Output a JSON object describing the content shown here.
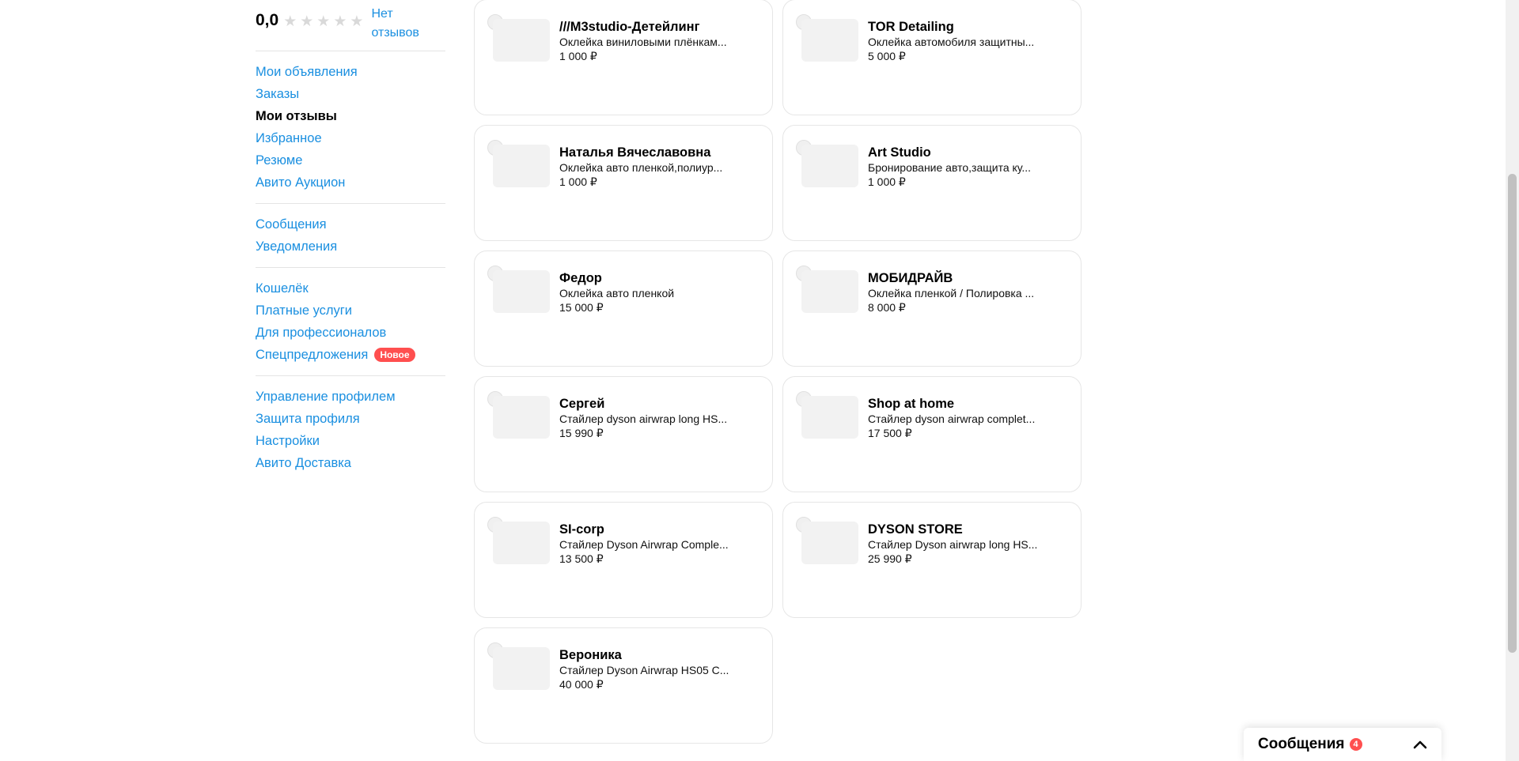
{
  "sidebar": {
    "rating": "0,0",
    "no_reviews": "Нет отзывов",
    "group1": [
      {
        "label": "Мои объявления"
      },
      {
        "label": "Заказы"
      },
      {
        "label": "Мои отзывы"
      },
      {
        "label": "Избранное"
      },
      {
        "label": "Резюме"
      },
      {
        "label": "Авито Аукцион"
      }
    ],
    "group2": [
      {
        "label": "Сообщения"
      },
      {
        "label": "Уведомления"
      }
    ],
    "group3": [
      {
        "label": "Кошелёк"
      },
      {
        "label": "Платные услуги"
      },
      {
        "label": "Для профессионалов"
      },
      {
        "label": "Спецпредложения",
        "badge": "Новое"
      }
    ],
    "group4": [
      {
        "label": "Управление профилем"
      },
      {
        "label": "Защита профиля"
      },
      {
        "label": "Настройки"
      },
      {
        "label": "Авито Доставка"
      }
    ]
  },
  "cards": [
    {
      "title": "///M3studio-Детейлинг",
      "desc": "Оклейка виниловыми плёнкам...",
      "price": "1 000 ₽"
    },
    {
      "title": "TOR Detailing",
      "desc": "Оклейка автомобиля защитны...",
      "price": "5 000 ₽"
    },
    {
      "title": "Наталья Вячеславовна",
      "desc": "Оклейка авто пленкой,полиур...",
      "price": "1 000 ₽"
    },
    {
      "title": "Art Studio",
      "desc": "Бронирование авто,защита ку...",
      "price": "1 000 ₽"
    },
    {
      "title": "Федор",
      "desc": "Оклейка авто пленкой",
      "price": "15 000 ₽"
    },
    {
      "title": "МОБИДРАЙВ",
      "desc": "Оклейка пленкой / Полировка ...",
      "price": "8 000 ₽"
    },
    {
      "title": "Сергей",
      "desc": "Стайлер dyson airwrap long HS...",
      "price": "15 990 ₽"
    },
    {
      "title": "Shop at home",
      "desc": "Стайлер dyson airwrap complet...",
      "price": "17 500 ₽"
    },
    {
      "title": "SI-corp",
      "desc": "Стайлер Dyson Airwrap Comple...",
      "price": "13 500 ₽"
    },
    {
      "title": "DYSON STORE",
      "desc": "Стайлер Dyson airwrap long HS...",
      "price": "25 990 ₽"
    },
    {
      "title": "Вероника",
      "desc": "Стайлер Dyson Airwrap HS05 C...",
      "price": "40 000 ₽"
    }
  ],
  "messages_widget": {
    "title": "Сообщения",
    "count": "4"
  }
}
